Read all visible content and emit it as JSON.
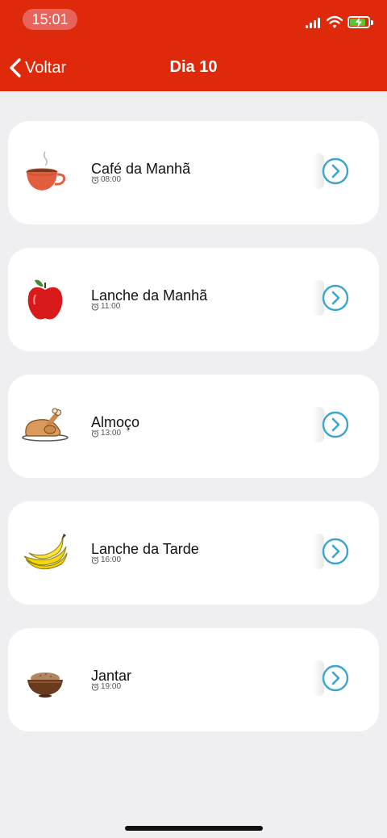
{
  "status_bar": {
    "time": "15:01"
  },
  "nav": {
    "back_label": "Voltar",
    "title": "Dia 10"
  },
  "meals": [
    {
      "name": "Café da Manhã",
      "time": "08:00",
      "icon": "tea-cup-icon"
    },
    {
      "name": "Lanche da Manhã",
      "time": "11:00",
      "icon": "apple-icon"
    },
    {
      "name": "Almoço",
      "time": "13:00",
      "icon": "roast-chicken-icon"
    },
    {
      "name": "Lanche da Tarde",
      "time": "16:00",
      "icon": "banana-icon"
    },
    {
      "name": "Jantar",
      "time": "19:00",
      "icon": "food-bowl-icon"
    }
  ],
  "colors": {
    "header": "#de2a0b",
    "accent": "#3aa6d0",
    "background": "#efeff1",
    "card": "#ffffff"
  }
}
